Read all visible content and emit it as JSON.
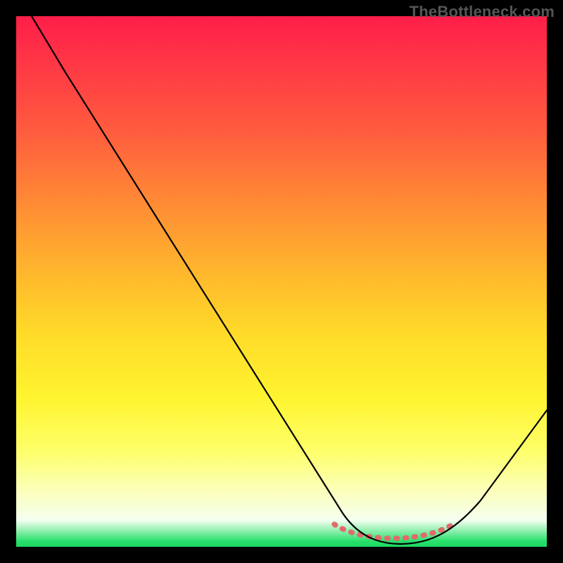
{
  "watermark": "TheBottleneck.com",
  "colors": {
    "frame": "#000000",
    "curve": "#000000",
    "dots": "#e06b6b",
    "gradient_top": "#ff1e4a",
    "gradient_bottom": "#1fd863"
  },
  "chart_data": {
    "type": "line",
    "title": "",
    "xlabel": "",
    "ylabel": "",
    "xlim": [
      0,
      100
    ],
    "ylim": [
      0,
      100
    ],
    "note": "V-shaped bottleneck curve on red→green vertical gradient; no axes or tick labels are visible. Minimum region is highlighted by a dotted salmon segment near the bottom.",
    "series": [
      {
        "name": "bottleneck-curve",
        "x": [
          3,
          10,
          20,
          30,
          40,
          50,
          58,
          63,
          67,
          71,
          75,
          79,
          82,
          85,
          90,
          95,
          100
        ],
        "values": [
          100,
          89,
          74,
          59,
          44,
          29,
          17,
          10,
          5,
          2,
          1,
          2,
          5,
          10,
          19,
          29,
          40
        ]
      }
    ],
    "highlight_dots": {
      "name": "min-region",
      "x_start": 60,
      "x_end": 83,
      "y": 4
    }
  }
}
